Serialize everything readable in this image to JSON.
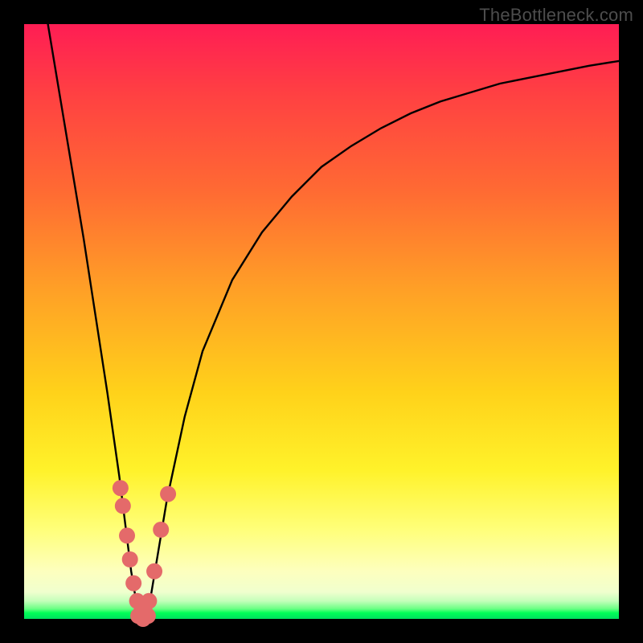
{
  "watermark": "TheBottleneck.com",
  "chart_data": {
    "type": "line",
    "title": "",
    "xlabel": "",
    "ylabel": "",
    "xlim": [
      0,
      100
    ],
    "ylim": [
      0,
      100
    ],
    "grid": false,
    "legend": false,
    "series": [
      {
        "name": "bottleneck-curve",
        "x": [
          4,
          6,
          8,
          10,
          12,
          14,
          16,
          17,
          18,
          19,
          20,
          21,
          22,
          24,
          27,
          30,
          35,
          40,
          45,
          50,
          55,
          60,
          65,
          70,
          75,
          80,
          85,
          90,
          95,
          100
        ],
        "y": [
          100,
          88,
          76,
          64,
          51,
          38,
          24,
          16,
          8,
          2,
          0,
          2,
          8,
          20,
          34,
          45,
          57,
          65,
          71,
          76,
          79.5,
          82.5,
          85,
          87,
          88.5,
          90,
          91,
          92,
          93,
          93.8
        ]
      }
    ],
    "markers": [
      {
        "name": "left-cluster",
        "color": "#e46a6a",
        "points": [
          {
            "x": 16.2,
            "y": 22
          },
          {
            "x": 16.6,
            "y": 19
          },
          {
            "x": 17.3,
            "y": 14
          },
          {
            "x": 17.8,
            "y": 10
          },
          {
            "x": 18.4,
            "y": 6
          },
          {
            "x": 19.0,
            "y": 3
          },
          {
            "x": 19.6,
            "y": 1
          }
        ]
      },
      {
        "name": "right-cluster",
        "color": "#e46a6a",
        "points": [
          {
            "x": 20.4,
            "y": 1
          },
          {
            "x": 21.0,
            "y": 3
          },
          {
            "x": 21.9,
            "y": 8
          },
          {
            "x": 23.0,
            "y": 15
          },
          {
            "x": 24.2,
            "y": 21
          }
        ]
      },
      {
        "name": "bottom-cluster",
        "color": "#e46a6a",
        "points": [
          {
            "x": 19.2,
            "y": 0.5
          },
          {
            "x": 20.0,
            "y": 0
          },
          {
            "x": 20.8,
            "y": 0.5
          }
        ]
      }
    ]
  }
}
